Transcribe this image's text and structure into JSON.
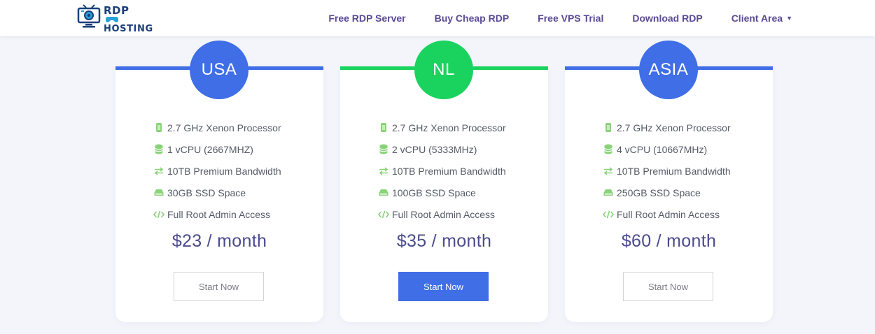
{
  "brand": {
    "line1": "RDP",
    "line2": "HOSTING",
    "color": "#1b3f7a",
    "accent": "#25a3d9"
  },
  "nav": [
    {
      "label": "Free RDP Server",
      "dropdown": false
    },
    {
      "label": "Buy Cheap RDP",
      "dropdown": false
    },
    {
      "label": "Free VPS Trial",
      "dropdown": false
    },
    {
      "label": "Download RDP",
      "dropdown": false
    },
    {
      "label": "Client Area",
      "dropdown": true,
      "icon": "caret-down-icon"
    }
  ],
  "plans": [
    {
      "region": "USA",
      "color": "#3f6ee6",
      "features": [
        {
          "icon": "cpu-icon",
          "text": "2.7 GHz Xenon Processor"
        },
        {
          "icon": "database-icon",
          "text": "1 vCPU (2667MHZ)"
        },
        {
          "icon": "exchange-arrows-icon",
          "text": "10TB Premium Bandwidth"
        },
        {
          "icon": "hard-drive-icon",
          "text": "30GB SSD Space"
        },
        {
          "icon": "code-icon",
          "text": "Full Root Admin Access"
        }
      ],
      "price": "$23 / month",
      "button": {
        "label": "Start Now",
        "primary": false
      }
    },
    {
      "region": "NL",
      "color": "#19d35e",
      "features": [
        {
          "icon": "cpu-icon",
          "text": "2.7 GHz Xenon Processor"
        },
        {
          "icon": "database-icon",
          "text": "2 vCPU (5333MHz)"
        },
        {
          "icon": "exchange-arrows-icon",
          "text": "10TB Premium Bandwidth"
        },
        {
          "icon": "hard-drive-icon",
          "text": "100GB SSD Space"
        },
        {
          "icon": "code-icon",
          "text": "Full Root Admin Access"
        }
      ],
      "price": "$35 / month",
      "button": {
        "label": "Start Now",
        "primary": true
      }
    },
    {
      "region": "ASIA",
      "color": "#3f6ee6",
      "features": [
        {
          "icon": "cpu-icon",
          "text": "2.7 GHz Xenon Processor"
        },
        {
          "icon": "database-icon",
          "text": "4 vCPU (10667MHz)"
        },
        {
          "icon": "exchange-arrows-icon",
          "text": "10TB Premium Bandwidth"
        },
        {
          "icon": "hard-drive-icon",
          "text": "250GB SSD Space"
        },
        {
          "icon": "code-icon",
          "text": "Full Root Admin Access"
        }
      ],
      "price": "$60 / month",
      "button": {
        "label": "Start Now",
        "primary": false
      }
    }
  ],
  "colors": {
    "feature_icon": "#8ad27a",
    "price": "#4b4b8e",
    "nav": "#5b4a94"
  }
}
